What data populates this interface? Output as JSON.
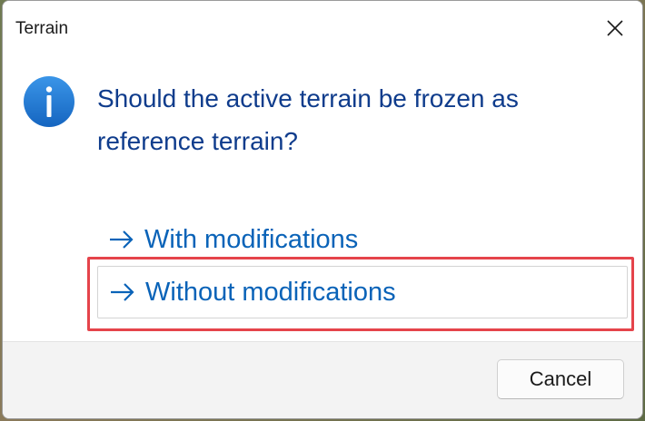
{
  "window": {
    "title": "Terrain",
    "close_icon": "close-icon"
  },
  "content": {
    "icon": "info-icon",
    "question": "Should the active terrain be frozen as reference terrain?"
  },
  "command_links": [
    {
      "label": "With modifications",
      "icon": "arrow-right-icon"
    },
    {
      "label": "Without modifications",
      "icon": "arrow-right-icon",
      "focused": true
    }
  ],
  "footer": {
    "cancel_label": "Cancel"
  },
  "colors": {
    "question_text": "#0f3c8c",
    "link_text": "#0a63b8",
    "info_icon": "#1976d2",
    "highlight": "#e5444b"
  }
}
